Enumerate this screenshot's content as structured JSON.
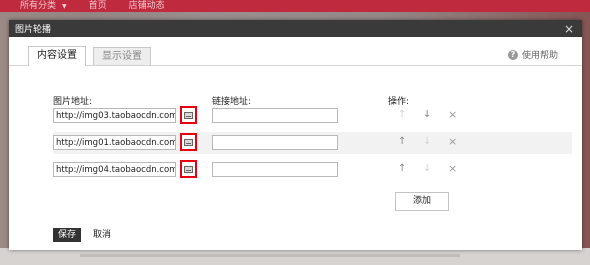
{
  "topnav": {
    "items": [
      "所有分类",
      "首页",
      "店铺动态"
    ]
  },
  "modal": {
    "title": "图片轮播",
    "close_label": "×",
    "tabs": [
      {
        "label": "内容设置",
        "active": true
      },
      {
        "label": "显示设置",
        "active": false
      }
    ],
    "help_label": "使用帮助",
    "columns": {
      "image_url": "图片地址:",
      "link_url": "链接地址:",
      "actions": "操作:"
    },
    "rows": [
      {
        "image_url": "http://img03.taobaocdn.com/",
        "link_url": ""
      },
      {
        "image_url": "http://img01.taobaocdn.com/",
        "link_url": ""
      },
      {
        "image_url": "http://img04.taobaocdn.com/",
        "link_url": ""
      }
    ],
    "icons": {
      "up": "↑",
      "down": "↓",
      "delete": "×"
    },
    "add_label": "添加",
    "save_label": "保存",
    "cancel_label": "取消"
  },
  "colors": {
    "nav_red": "#c02a3f",
    "header_dark": "#3a3a3a",
    "highlight_red": "#e60012"
  }
}
